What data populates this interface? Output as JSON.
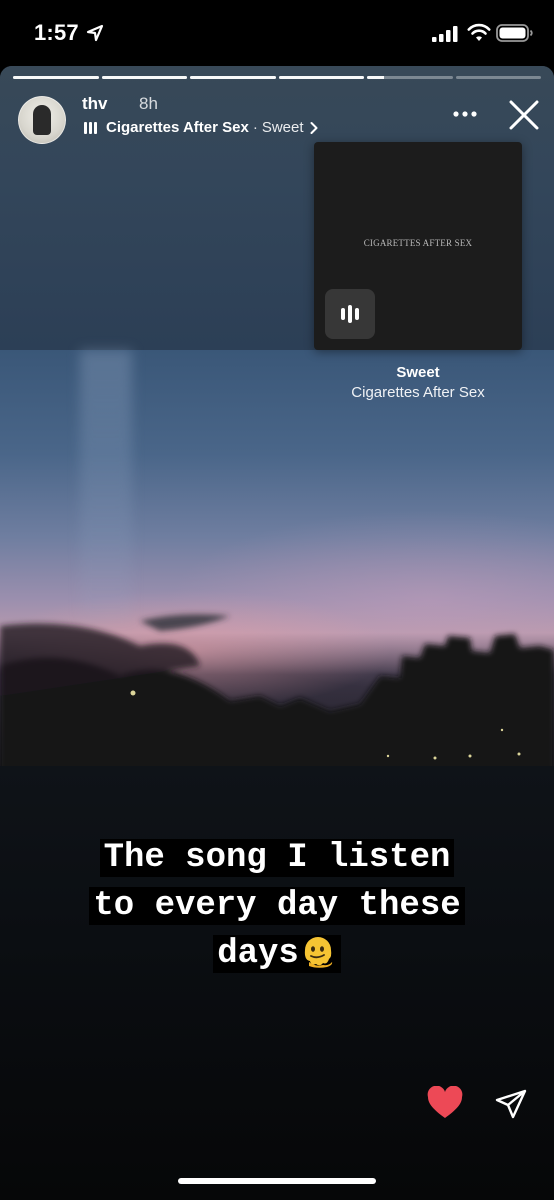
{
  "status_bar": {
    "time": "1:57",
    "icons": [
      "location-arrow-icon",
      "cellular-signal-icon",
      "wifi-icon",
      "battery-icon"
    ]
  },
  "story": {
    "progress": [
      1,
      1,
      1,
      1,
      0.2,
      0
    ],
    "user": {
      "username": "thv",
      "time_ago": "8h"
    },
    "music_sticker": {
      "artist": "Cigarettes After Sex",
      "separator": "·",
      "song": "Sweet",
      "album_text": "CIGARETTES AFTER SEX",
      "title": "Sweet",
      "artist_line": "Cigarettes After Sex"
    },
    "caption": {
      "line1": "The song I listen",
      "line2": "to every day these",
      "line3": "days"
    },
    "actions": {
      "like_color": "#ed4956"
    }
  }
}
